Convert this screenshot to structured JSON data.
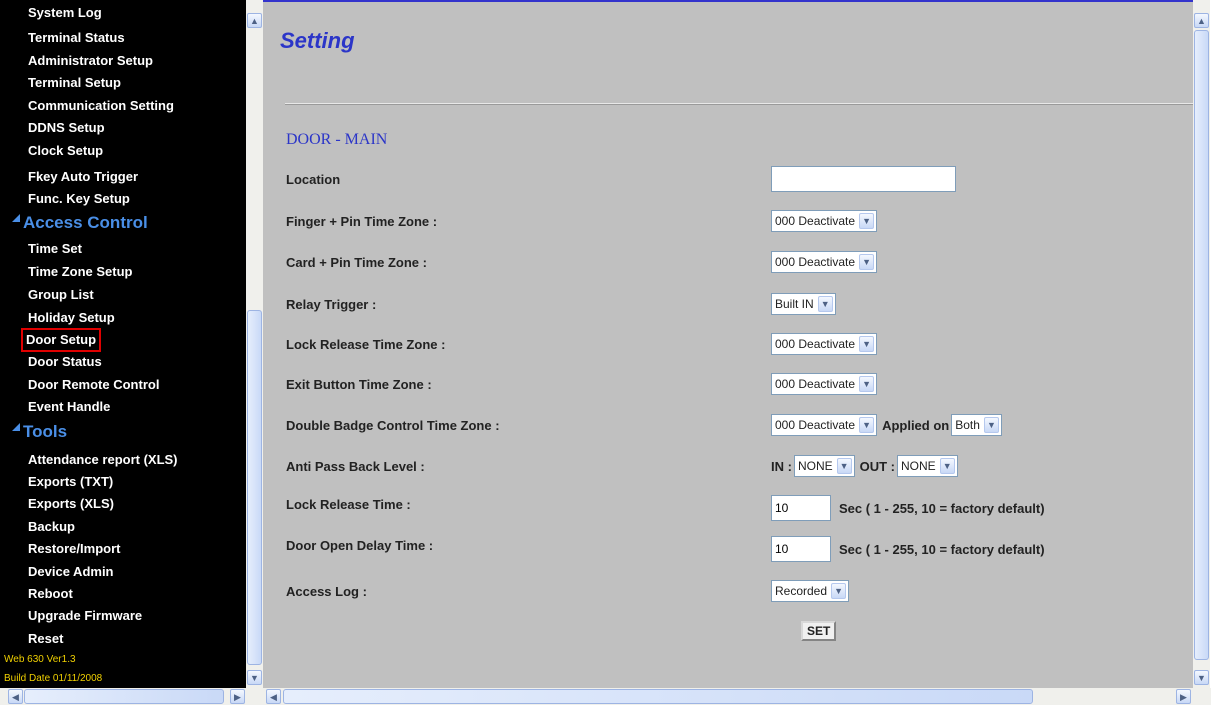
{
  "left_nav": {
    "items_top": [
      "System Log",
      "Terminal Status",
      "Administrator Setup",
      "Terminal Setup",
      "Communication Setting",
      "DDNS Setup",
      "Clock Setup",
      "Fkey Auto Trigger",
      "Func. Key Setup"
    ],
    "access_control": {
      "heading": "Access Control",
      "items": [
        "Time Set",
        "Time Zone Setup",
        "Group List",
        "Holiday Setup",
        "Door Setup",
        "Door Status",
        "Door Remote Control",
        "Event Handle"
      ],
      "selected": "Door Setup"
    },
    "tools": {
      "heading": "Tools",
      "items": [
        "Attendance report (XLS)",
        "Exports (TXT)",
        "Exports (XLS)",
        "Backup",
        "Restore/Import",
        "Device Admin",
        "Reboot",
        "Upgrade Firmware",
        "Reset"
      ]
    },
    "version": "Web 630 Ver1.3",
    "build_date": "Build Date 01/11/2008"
  },
  "page": {
    "title": "Setting",
    "section": "DOOR - MAIN"
  },
  "form": {
    "location_label": "Location",
    "location_value": "",
    "finger_pin_label": "Finger + Pin Time Zone :",
    "finger_pin_value": "000 Deactivate",
    "card_pin_label": "Card + Pin Time Zone :",
    "card_pin_value": "000 Deactivate",
    "relay_label": "Relay Trigger :",
    "relay_value": "Built IN",
    "lock_tz_label": "Lock Release Time Zone :",
    "lock_tz_value": "000 Deactivate",
    "exit_tz_label": "Exit Button Time Zone :",
    "exit_tz_value": "000 Deactivate",
    "double_badge_label": "Double Badge Control Time Zone :",
    "double_badge_value": "000 Deactivate",
    "applied_on_label": "Applied on",
    "applied_on_value": "Both",
    "anti_pass_label": "Anti Pass Back Level :",
    "in_label": "IN :",
    "in_value": "NONE",
    "out_label": "OUT :",
    "out_value": "NONE",
    "lock_time_label": "Lock Release Time  :",
    "lock_time_value": "10",
    "door_delay_label": "Door Open Delay Time  :",
    "door_delay_value": "10",
    "sec_hint": "Sec ( 1 - 255, 10 = factory default)",
    "access_log_label": "Access Log :",
    "access_log_value": "Recorded",
    "set_label": "SET"
  },
  "icons": {
    "scroll_up": "up-arrow",
    "scroll_down": "down-arrow",
    "scroll_left": "left-arrow",
    "scroll_right": "right-arrow",
    "dropdown": "chevron-down",
    "category_marker": "triangle"
  },
  "colors": {
    "nav_bg": "#000000",
    "nav_text": "#ffffff",
    "category": "#4a8fe7",
    "title": "#2b35c8",
    "content_bg": "#c0c0c0",
    "selected_outline": "#e00000",
    "version_text": "#f0d000"
  }
}
